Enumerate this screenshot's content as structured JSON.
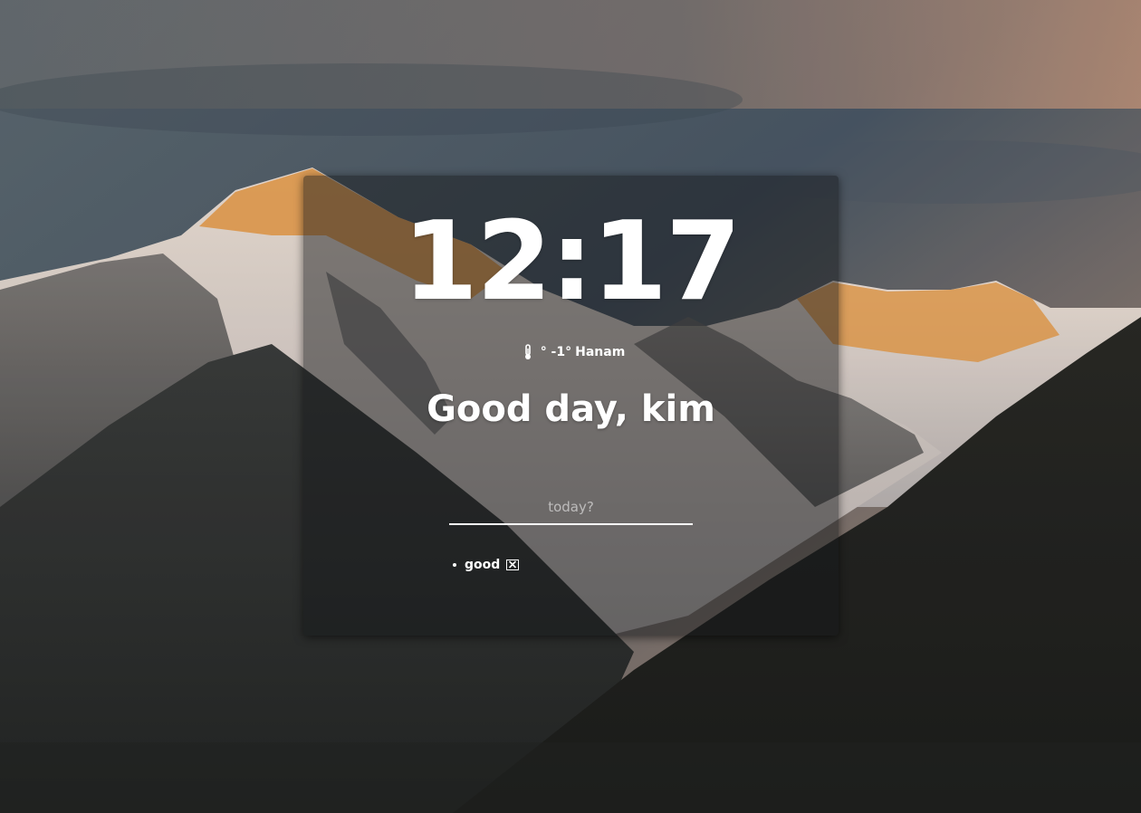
{
  "clock": {
    "time": "12:17"
  },
  "weather": {
    "icon": "thermometer-icon",
    "temperature": "° -1°",
    "city": "Hanam"
  },
  "greeting": {
    "text": "Good day, kim"
  },
  "todo": {
    "placeholder": "today?",
    "value": "",
    "items": [
      {
        "text": "good",
        "delete_icon": "close-box-icon"
      }
    ]
  },
  "colors": {
    "text": "#ffffff",
    "card_overlay": "rgba(20,22,26,0.48)",
    "sunlit_peak": "#e79a45"
  }
}
